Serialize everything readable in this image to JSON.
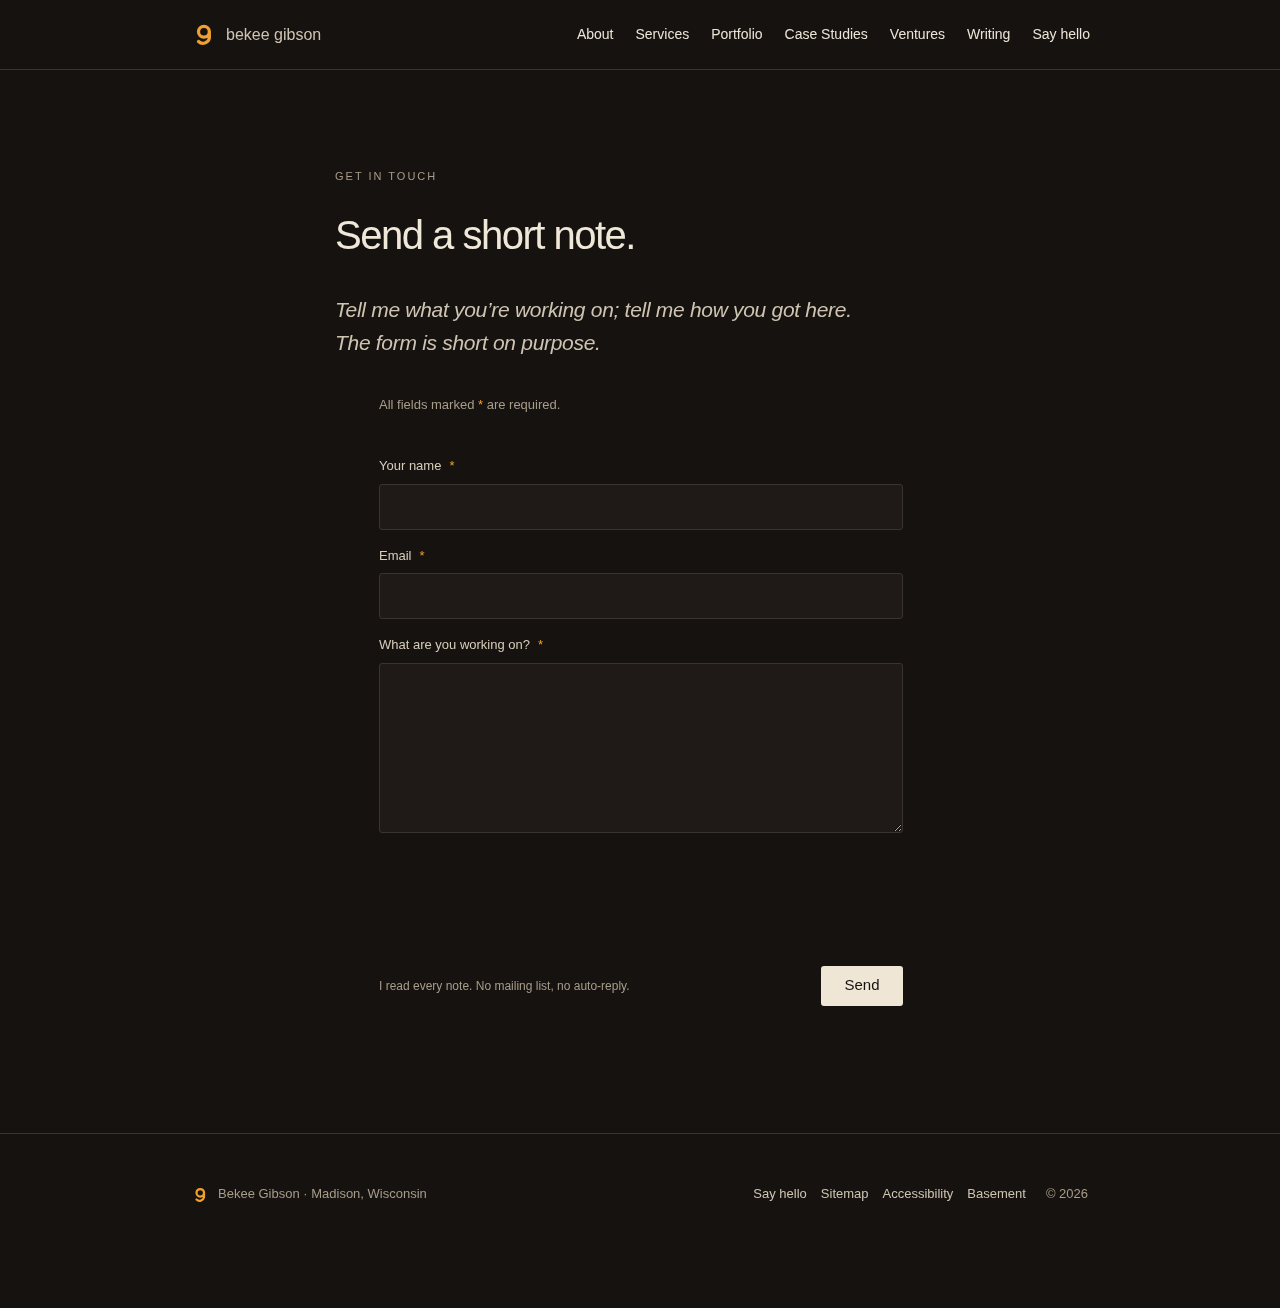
{
  "header": {
    "site_name": "bekee gibson",
    "nav": [
      {
        "label": "About"
      },
      {
        "label": "Services"
      },
      {
        "label": "Portfolio"
      },
      {
        "label": "Case Studies"
      },
      {
        "label": "Ventures"
      },
      {
        "label": "Writing"
      },
      {
        "label": "Say hello"
      }
    ]
  },
  "main": {
    "eyebrow": "GET IN TOUCH",
    "title": "Send a short note.",
    "intro": [
      "Tell me what you’re working on; tell me how you got here.",
      "The form is short on purpose."
    ],
    "required_note": {
      "before": "All fields marked",
      "mark": "*",
      "after": "are required."
    },
    "fields": [
      {
        "kind": "input",
        "label": "Your name",
        "required": true
      },
      {
        "kind": "input",
        "label": "Email",
        "required": true
      },
      {
        "kind": "textarea",
        "label": "What are you working on?",
        "required": true
      }
    ],
    "footnote": "I read every note. No mailing list, no auto-reply.",
    "submit": "Send"
  },
  "footer": {
    "credit": "Bekee Gibson · Madison, Wisconsin",
    "links": [
      "Say hello",
      "Sitemap",
      "Accessibility",
      "Basement"
    ],
    "copyright": "© 2026"
  }
}
